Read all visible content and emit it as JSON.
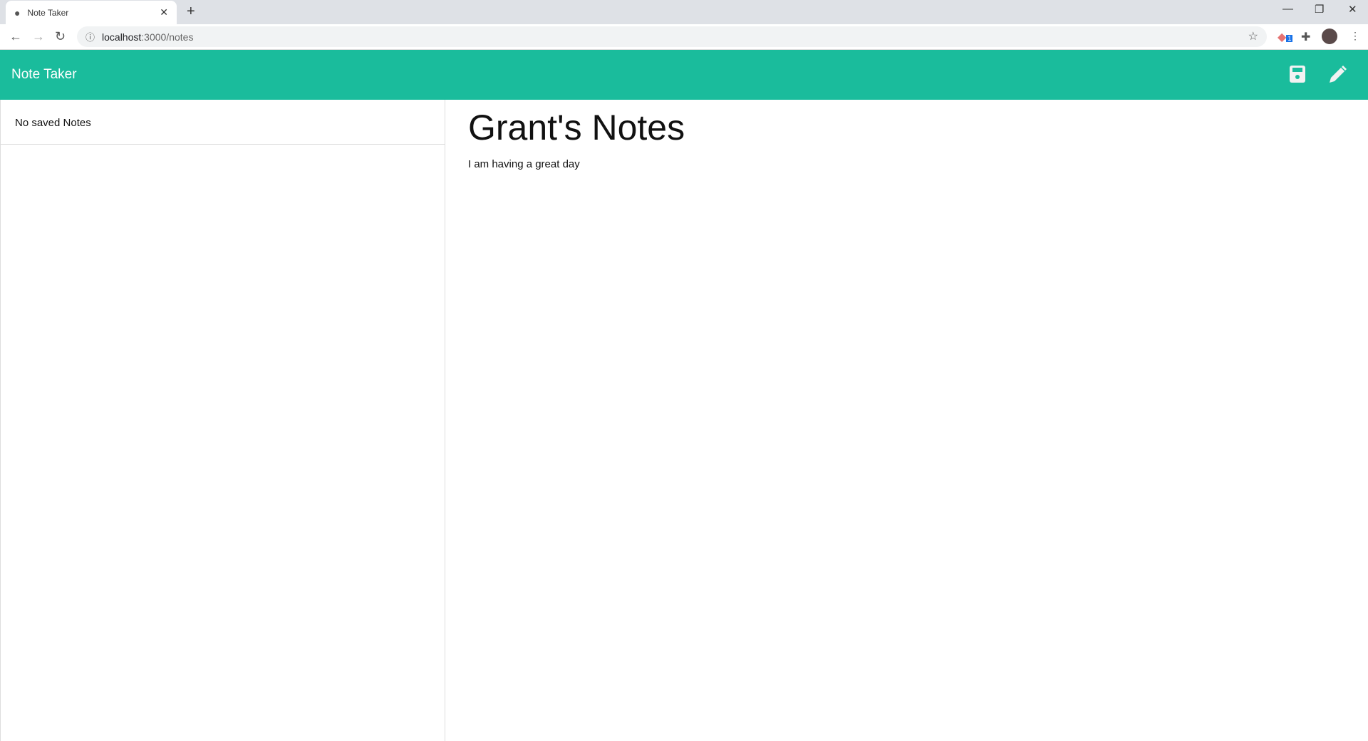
{
  "browser": {
    "tab_title": "Note Taker",
    "url_host": "localhost",
    "url_path": ":3000/notes",
    "extension_badge": "1"
  },
  "app": {
    "brand": "Note Taker",
    "accent": "#1abc9c"
  },
  "sidebar": {
    "empty_message": "No saved Notes"
  },
  "note": {
    "title": "Grant's Notes",
    "text": "I am having a great day"
  },
  "icons": [
    "globe-icon",
    "close-icon",
    "plus-icon",
    "back-icon",
    "forward-icon",
    "reload-icon",
    "info-icon",
    "star-icon",
    "puzzle-icon",
    "save-icon",
    "pencil-icon"
  ]
}
